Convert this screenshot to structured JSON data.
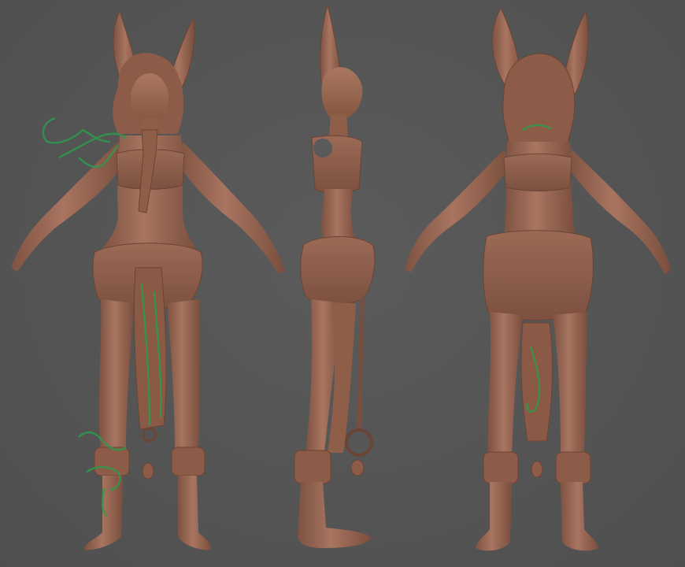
{
  "scene": {
    "background_color": "#555555",
    "clay_color": "#9c6b54",
    "clay_shadow_color": "#6e4636",
    "clay_highlight_color": "#b98670",
    "paint_overlay_color": "#2f9a4e",
    "views": [
      "front",
      "side",
      "back"
    ]
  }
}
